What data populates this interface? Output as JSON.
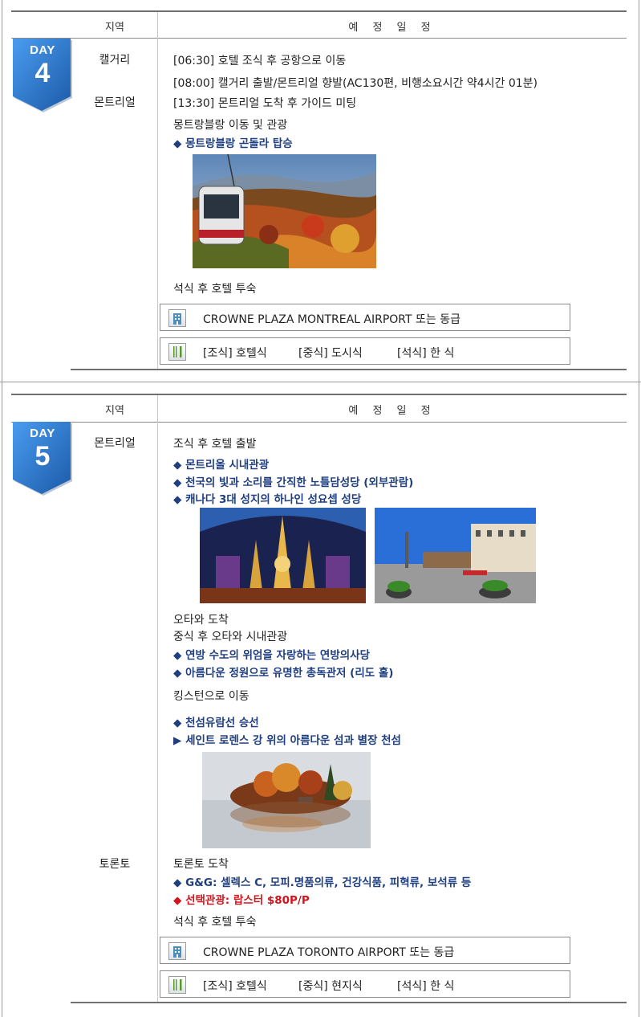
{
  "header": {
    "region": "지역",
    "schedule": "예 정 일 정"
  },
  "days": [
    {
      "badge": {
        "label": "DAY",
        "number": "4"
      },
      "regions": [
        "캘거리",
        "몬트리얼"
      ],
      "lines": [
        "[06:30] 호텔 조식 후 공항으로 이동",
        "[08:00] 캘거리 출발/몬트리얼 향발(AC130편, 비행소요시간 약4시간 01분)",
        "[13:30] 몬트리얼 도착 후 가이드 미팅",
        "몽트랑블랑 이동 및 관광",
        "◆ 몽트랑블랑 곤돌라 탑승",
        "석식 후 호텔 투숙"
      ],
      "hotel": "CROWNE PLAZA MONTREAL AIRPORT 또는 동급",
      "meals": {
        "breakfast": "[조식] 호텔식",
        "lunch": "[중식] 도시식",
        "dinner": "[석식] 한  식"
      },
      "icons": {
        "hotel": "hotel-building-icon",
        "meal": "fork-knife-icon",
        "photo": "gondola-photo"
      }
    },
    {
      "badge": {
        "label": "DAY",
        "number": "5"
      },
      "regions": [
        "몬트리얼",
        "토론토"
      ],
      "lines": [
        "조식 후 호텔 출발",
        "◆ 몬트리올 시내관광",
        "◆ 천국의 빛과 소리를 간직한 노틀담성당 (외부관람)",
        "◆ 캐나다 3대 성지의 하나인 성요셉 성당",
        "오타와 도착",
        "중식 후 오타와 시내관광",
        "◆ 연방 수도의 위엄을 자랑하는 연방의사당",
        "◆ 아름다운 정원으로 유명한 총독관저 (리도 홀)",
        "킹스턴으로 이동",
        "◆ 천섬유람선 승선",
        "▶ 세인트 로렌스 강 위의 아름다운 섬과 별장 천섬",
        "토론토 도착",
        "◆ G&G: 셀렉스 C, 모피.명품의류, 건강식품, 피혁류, 보석류 등",
        "◆ 선택관광: 랍스터 $80P/P",
        "석식 후 호텔 투숙"
      ],
      "hotel": "CROWNE PLAZA TORONTO AIRPORT 또는 동급",
      "meals": {
        "breakfast": "[조식] 호텔식",
        "lunch": "[중식] 현지식",
        "dinner": "[석식] 한  식"
      },
      "icons": {
        "hotel": "hotel-building-icon",
        "meal": "fork-knife-icon"
      }
    }
  ],
  "colors": {
    "badge": "#2f7fd6",
    "badge_dark": "#1c5aa8",
    "highlight": "#1f3f80",
    "optional": "#d2141c"
  }
}
